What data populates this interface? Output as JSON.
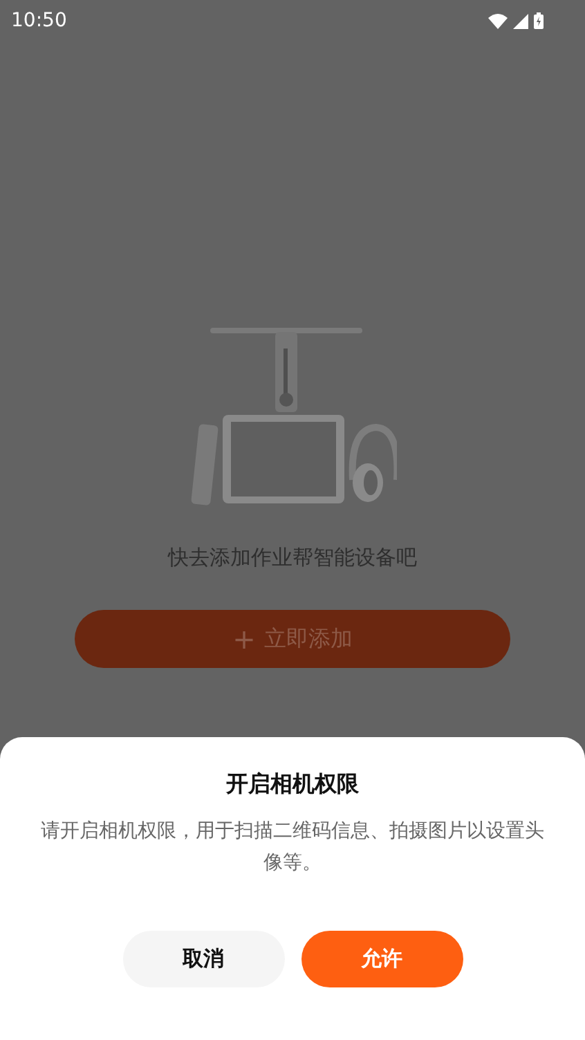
{
  "status_bar": {
    "time": "10:50"
  },
  "empty_state": {
    "message": "快去添加作业帮智能设备吧",
    "add_button": {
      "icon": "+",
      "label": "立即添加"
    }
  },
  "dialog": {
    "title": "开启相机权限",
    "message": "请开启相机权限，用于扫描二维码信息、拍摄图片以设置头像等。",
    "buttons": [
      {
        "label": "取消",
        "kind": "secondary"
      },
      {
        "label": "允许",
        "kind": "primary"
      }
    ]
  }
}
